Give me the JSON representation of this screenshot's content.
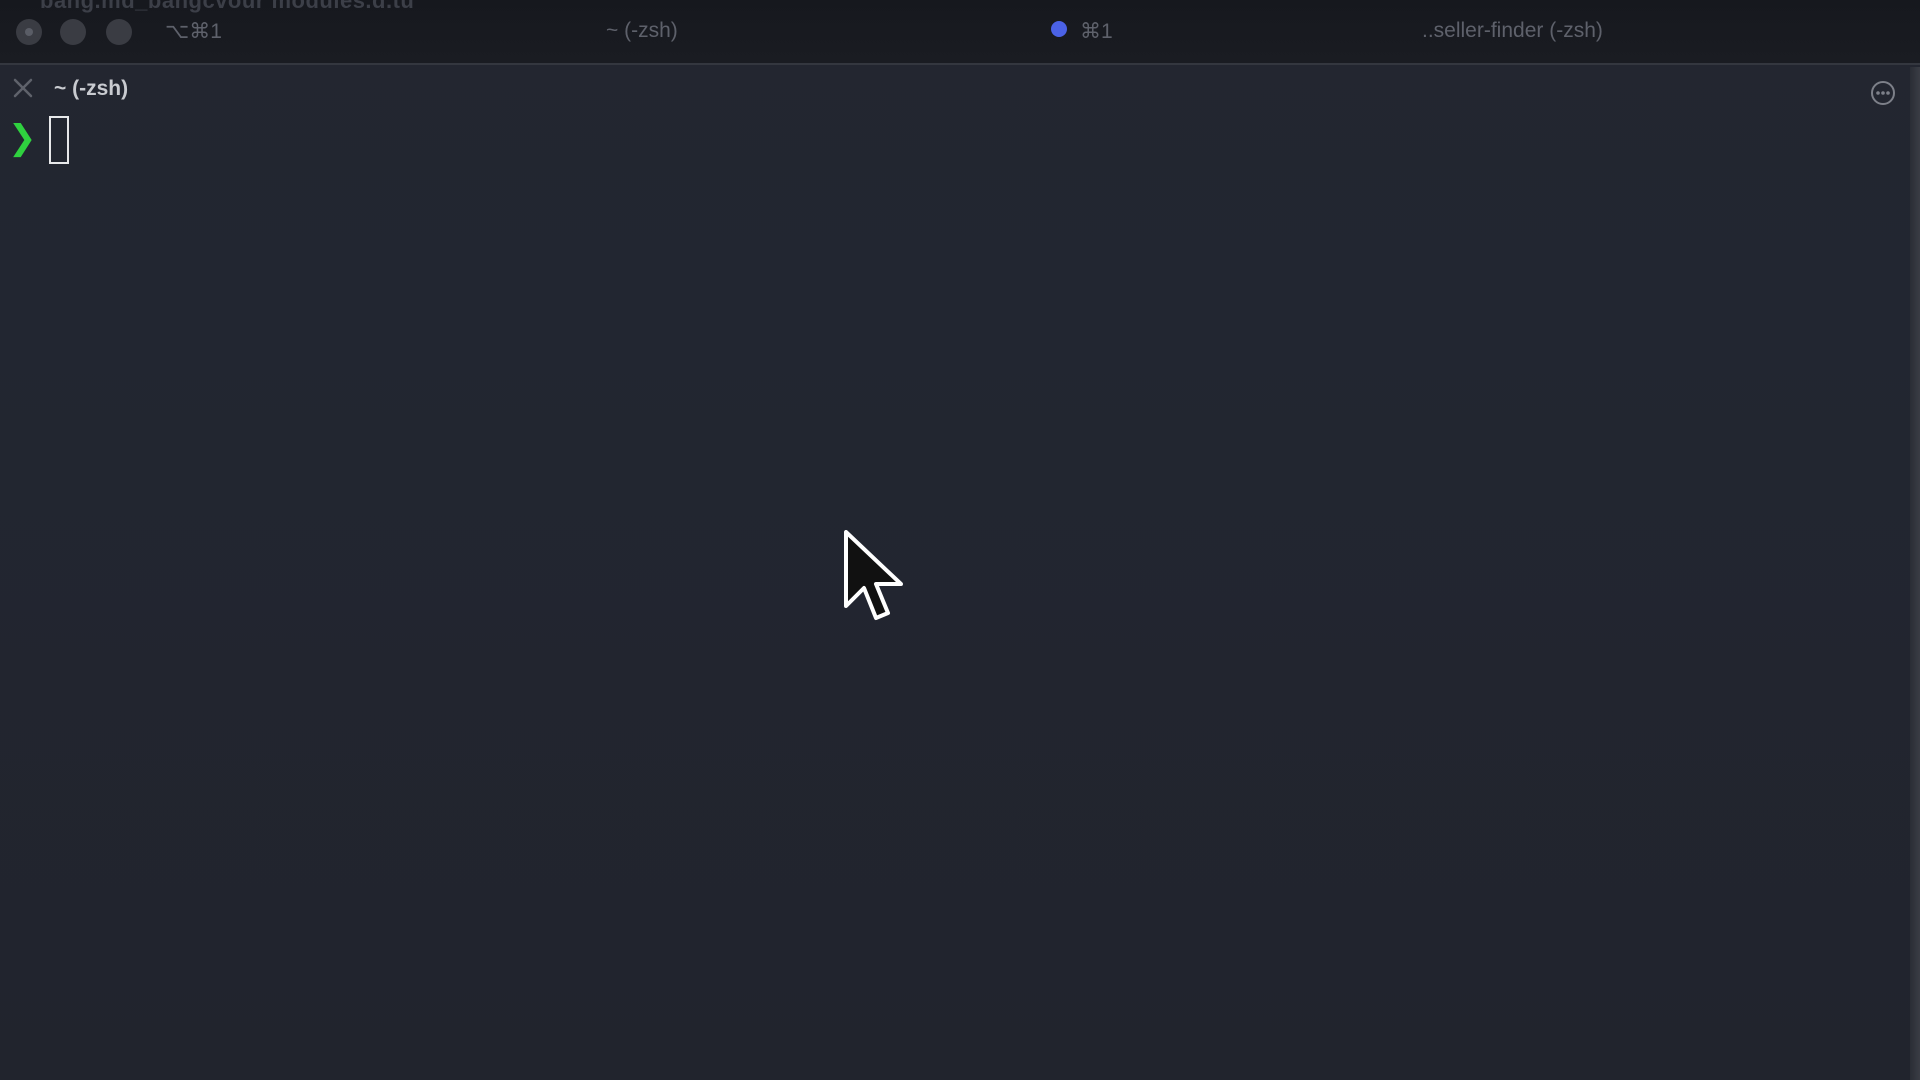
{
  "window": {
    "faded_title": "bang.md_bangcvour modules.d.tu",
    "tabs": [
      {
        "label": "⌥⌘1"
      },
      {
        "label": "~ (-zsh)"
      },
      {
        "label": "⌘1",
        "active_dot_color": "#4b62e6"
      },
      {
        "label": "..seller-finder (-zsh)"
      }
    ]
  },
  "session": {
    "title": "~ (-zsh)",
    "close_icon": "close-icon",
    "menu_icon": "more-options-icon"
  },
  "terminal": {
    "prompt_symbol": "❯",
    "prompt_color": "#2fd13f",
    "input_value": ""
  },
  "pointer": {
    "icon": "mouse-pointer-icon"
  }
}
